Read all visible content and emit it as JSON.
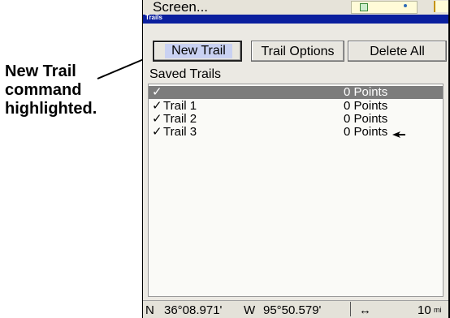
{
  "callout": {
    "lines": [
      "New Trail",
      "command",
      "highlighted."
    ]
  },
  "topbar": {
    "menu_title": "Screen..."
  },
  "dialog": {
    "title": "Trails"
  },
  "buttons": {
    "new_trail": "New Trail",
    "trail_options": "Trail Options",
    "delete_all": "Delete All"
  },
  "saved_trails_label": "Saved Trails",
  "trails": [
    {
      "check": "✓",
      "name": "",
      "points": "0 Points",
      "selected": true
    },
    {
      "check": "✓",
      "name": "Trail 1",
      "points": "0 Points",
      "selected": false
    },
    {
      "check": "✓",
      "name": "Trail 2",
      "points": "0 Points",
      "selected": false
    },
    {
      "check": "✓",
      "name": "Trail 3",
      "points": "0 Points",
      "selected": false
    }
  ],
  "status": {
    "lat_hemi": "N",
    "lat": "36°08.971'",
    "lon_hemi": "W",
    "lon": "95°50.579'",
    "scale_icon": "↔",
    "scale": "10",
    "scale_unit": "mi"
  },
  "colors": {
    "title_bar": "#0a1f9e",
    "highlight": "#c9d1f2",
    "selected_row": "#7c7c7c"
  }
}
